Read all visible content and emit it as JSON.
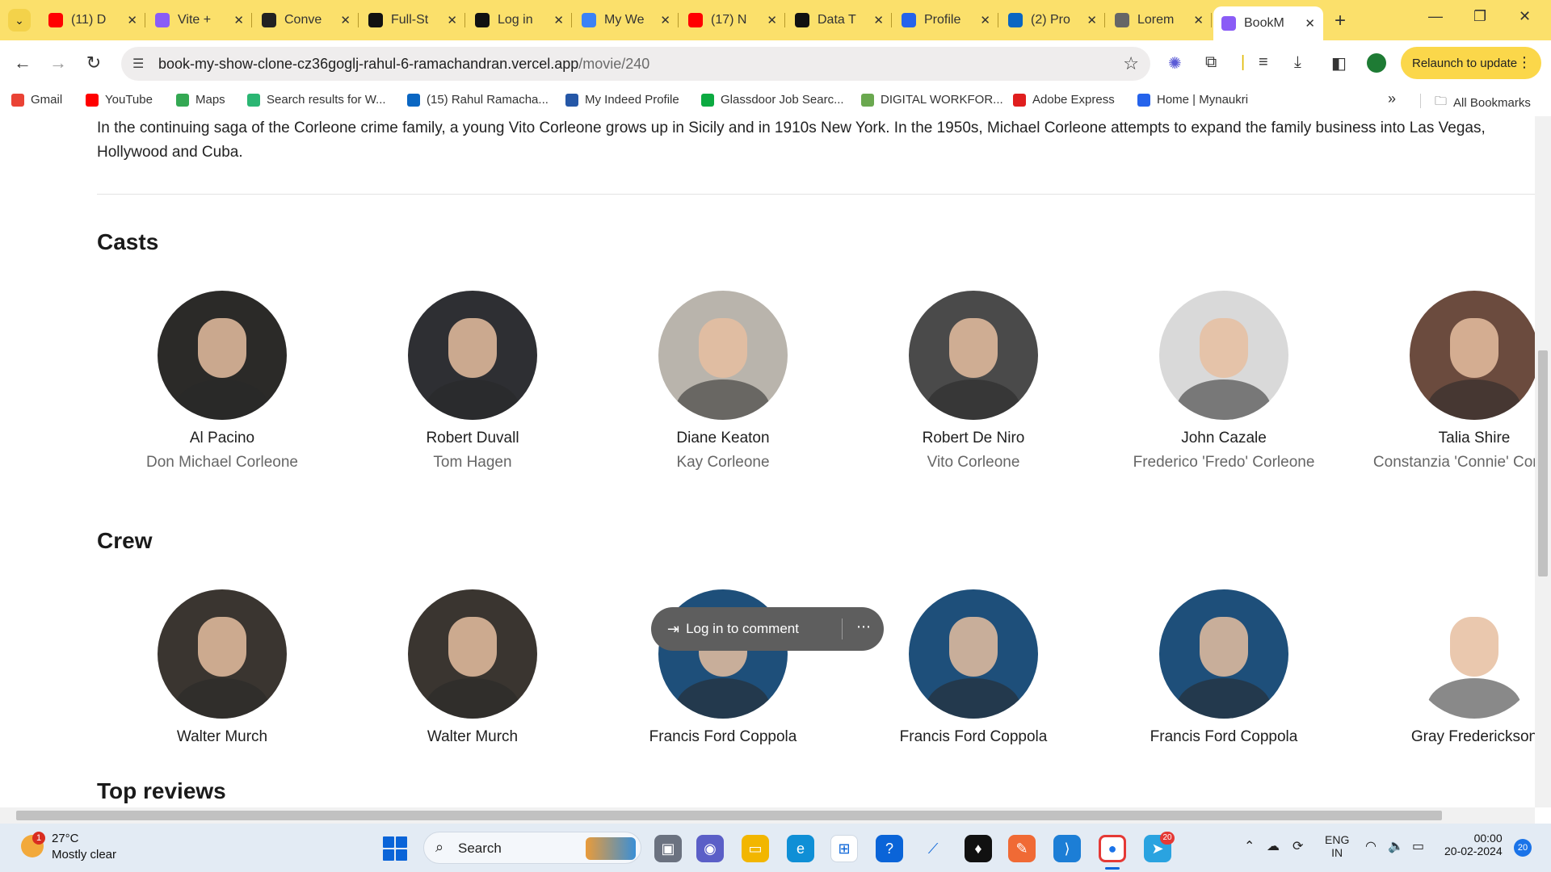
{
  "browser": {
    "tabs": [
      {
        "title": "(11) D",
        "favicon": "youtube-icon",
        "color": "#ff0000"
      },
      {
        "title": "Vite +",
        "favicon": "vite-icon",
        "color": "#8a5cf6"
      },
      {
        "title": "Conve",
        "favicon": "w-icon",
        "color": "#222222"
      },
      {
        "title": "Full-St",
        "favicon": "site-icon",
        "color": "#111111"
      },
      {
        "title": "Log in",
        "favicon": "leaf-icon",
        "color": "#111111"
      },
      {
        "title": "My We",
        "favicon": "r-icon",
        "color": "#3b82f6"
      },
      {
        "title": "(17) N",
        "favicon": "youtube-icon",
        "color": "#ff0000"
      },
      {
        "title": "Data T",
        "favicon": "notion-icon",
        "color": "#111111"
      },
      {
        "title": "Profile",
        "favicon": "k-icon",
        "color": "#2563eb"
      },
      {
        "title": "(2) Pro",
        "favicon": "linkedin-icon",
        "color": "#0a66c2"
      },
      {
        "title": "Lorem",
        "favicon": "globe-icon",
        "color": "#666666"
      },
      {
        "title": "BookM",
        "favicon": "vite-icon",
        "color": "#8a5cf6",
        "active": true
      }
    ],
    "url_host": "book-my-show-clone-cz36goglj-rahul-6-ramachandran.vercel.app",
    "url_path": "/movie/240",
    "relaunch_label": "Relaunch to update",
    "bookmarks": [
      {
        "label": "Gmail",
        "color": "#ea4335"
      },
      {
        "label": "YouTube",
        "color": "#ff0000"
      },
      {
        "label": "Maps",
        "color": "#34a853"
      },
      {
        "label": "Search results for W...",
        "color": "#2bb673"
      },
      {
        "label": "(15) Rahul Ramacha...",
        "color": "#0a66c2"
      },
      {
        "label": "My Indeed Profile",
        "color": "#2557a7"
      },
      {
        "label": "Glassdoor Job Searc...",
        "color": "#0caa41"
      },
      {
        "label": "DIGITAL WORKFOR...",
        "color": "#6aa84f"
      },
      {
        "label": "Adobe Express",
        "color": "#e01e1e"
      },
      {
        "label": "Home | Mynaukri",
        "color": "#2563eb"
      }
    ],
    "all_bookmarks_label": "All Bookmarks"
  },
  "page": {
    "synopsis": "In the continuing saga of the Corleone crime family, a young Vito Corleone grows up in Sicily and in 1910s New York. In the 1950s, Michael Corleone attempts to expand the family business into Las Vegas, Hollywood and Cuba.",
    "casts_title": "Casts",
    "casts": [
      {
        "name": "Al Pacino",
        "role": "Don Michael Corleone"
      },
      {
        "name": "Robert Duvall",
        "role": "Tom Hagen"
      },
      {
        "name": "Diane Keaton",
        "role": "Kay Corleone"
      },
      {
        "name": "Robert De Niro",
        "role": "Vito Corleone"
      },
      {
        "name": "John Cazale",
        "role": "Frederico 'Fredo' Corleone"
      },
      {
        "name": "Talia Shire",
        "role": "Constanzia 'Connie' Corleone"
      }
    ],
    "crew_title": "Crew",
    "crew": [
      {
        "name": "Walter Murch"
      },
      {
        "name": "Walter Murch"
      },
      {
        "name": "Francis Ford Coppola"
      },
      {
        "name": "Francis Ford Coppola"
      },
      {
        "name": "Francis Ford Coppola"
      },
      {
        "name": "Gray Frederickson"
      }
    ],
    "reviews_title": "Top reviews",
    "toast_label": "Log in to comment",
    "toast_more": "⋯"
  },
  "taskbar": {
    "weather_temp": "27°C",
    "weather_desc": "Mostly clear",
    "weather_badge": "1",
    "search_label": "Search",
    "telegram_badge": "20",
    "lang_line1": "ENG",
    "lang_line2": "IN",
    "time": "00:00",
    "date": "20-02-2024",
    "notif_count": "20"
  }
}
